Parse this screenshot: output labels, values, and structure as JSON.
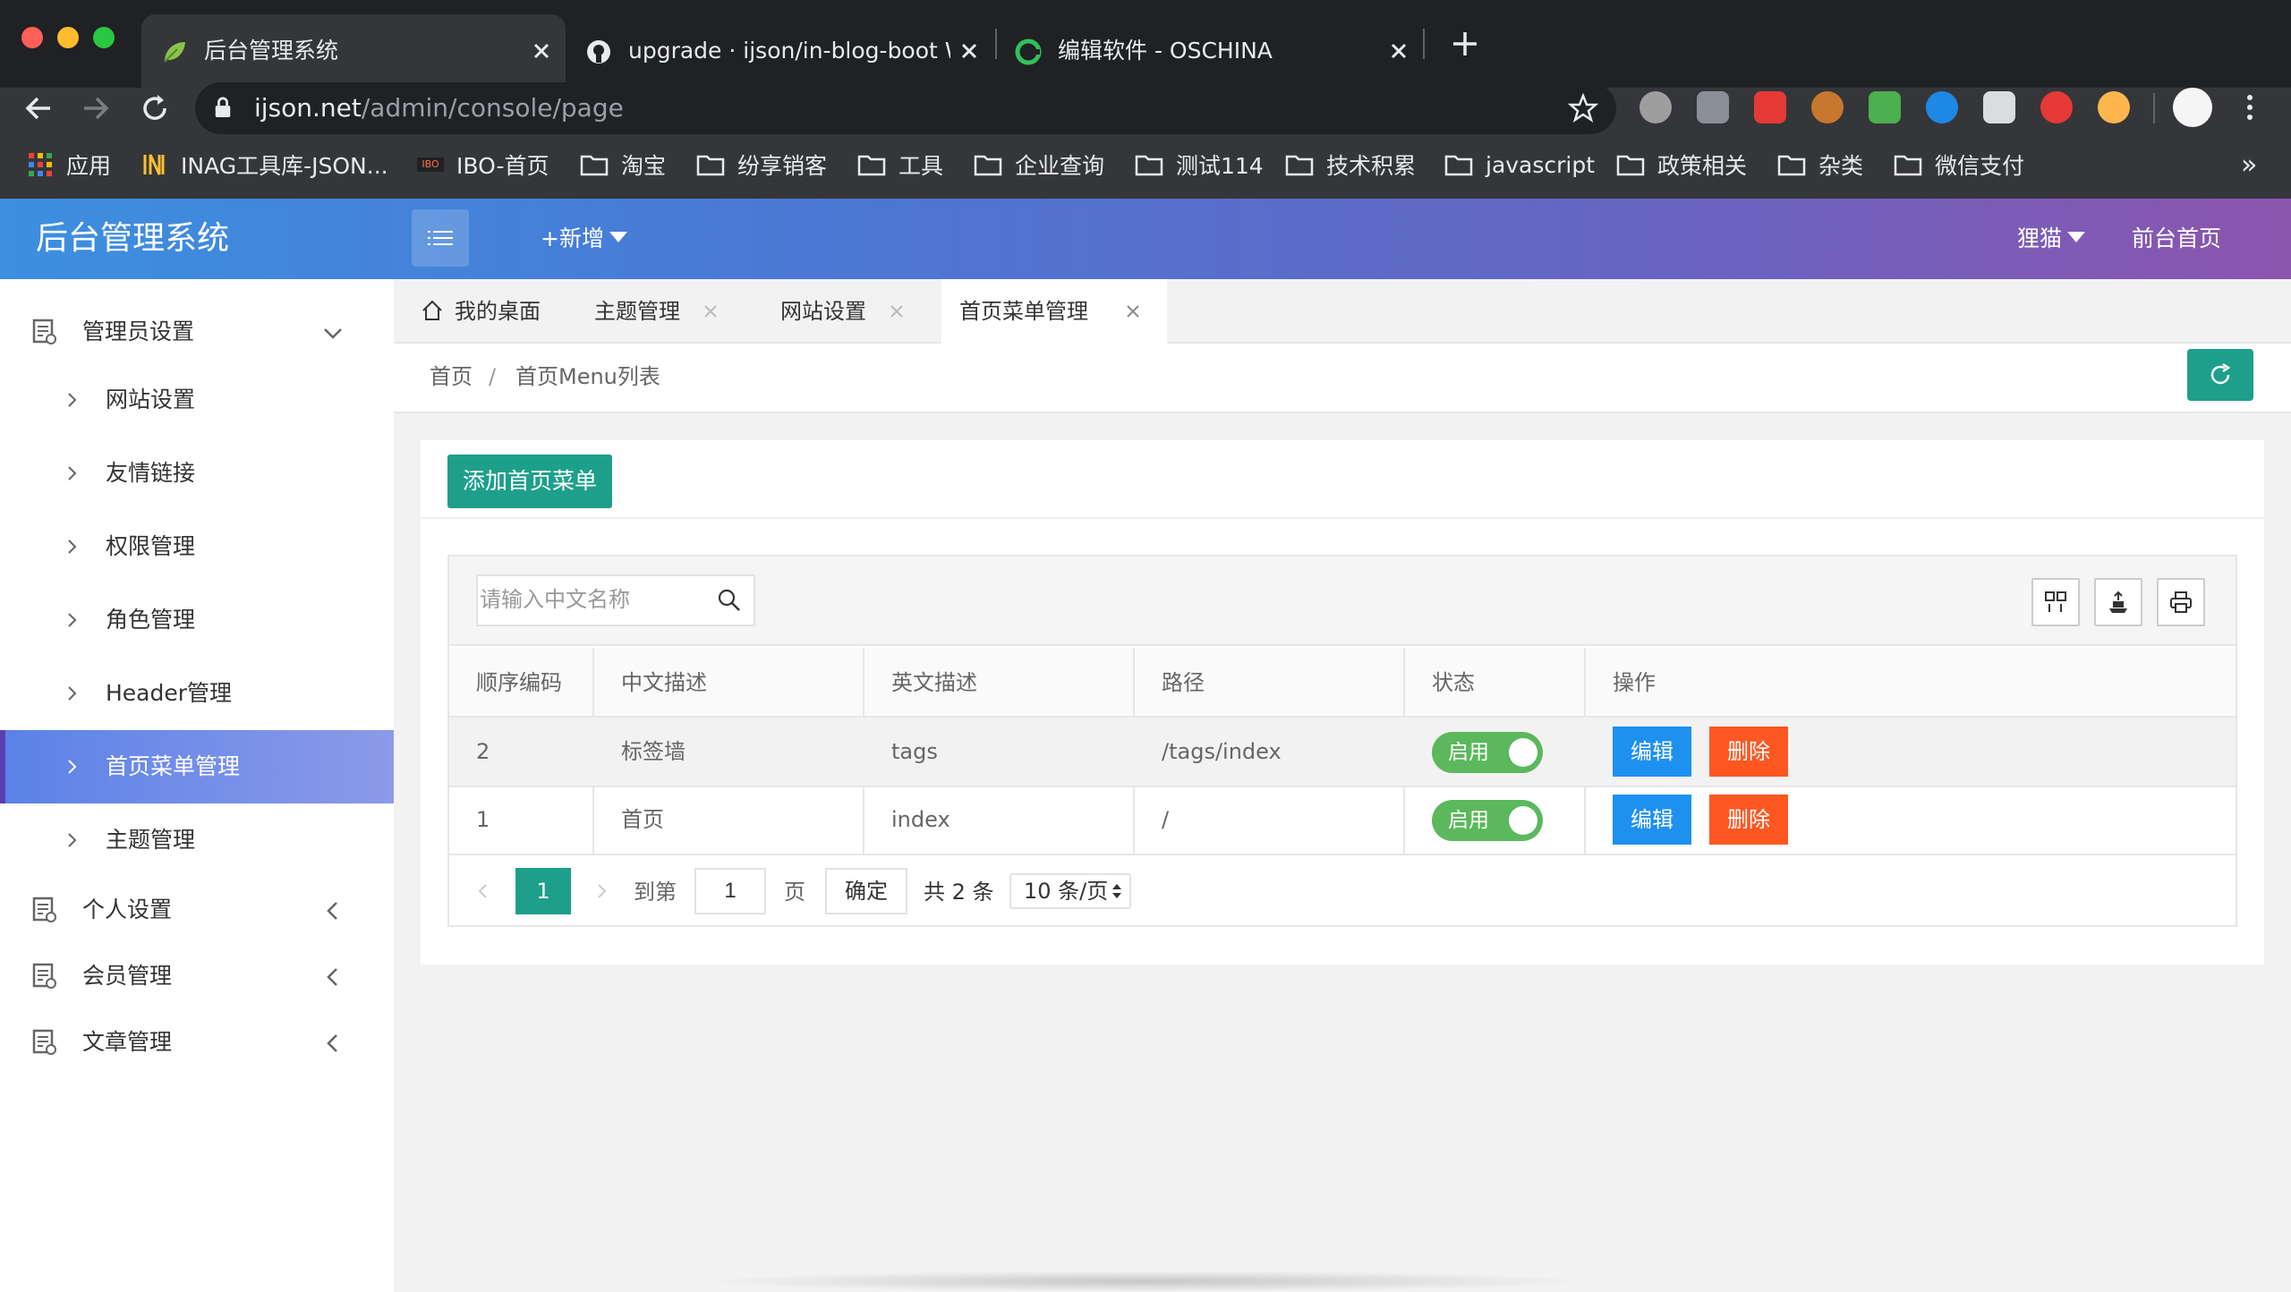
{
  "browser": {
    "tabs": [
      {
        "title": "后台管理系统",
        "favicon": "leaf-icon",
        "active": true
      },
      {
        "title": "upgrade · ijson/in-blog-boot W",
        "favicon": "github-icon",
        "active": false
      },
      {
        "title": "编辑软件 - OSCHINA",
        "favicon": "oschina-icon",
        "active": false
      }
    ],
    "new_tab_symbol": "+",
    "url_host": "ijson.net",
    "url_path": "/admin/console/page",
    "bookmarks": [
      {
        "label": "应用",
        "icon": "apps-grid-icon"
      },
      {
        "label": "INAG工具库-JSON...",
        "icon": "inag-logo-icon"
      },
      {
        "label": "IBO-首页",
        "icon": "ibo-logo-icon"
      },
      {
        "label": "淘宝",
        "icon": "folder-icon"
      },
      {
        "label": "纷享销客",
        "icon": "folder-icon"
      },
      {
        "label": "工具",
        "icon": "folder-icon"
      },
      {
        "label": "企业查询",
        "icon": "folder-icon"
      },
      {
        "label": "测试114",
        "icon": "folder-icon"
      },
      {
        "label": "技术积累",
        "icon": "folder-icon"
      },
      {
        "label": "javascript",
        "icon": "folder-icon"
      },
      {
        "label": "政策相关",
        "icon": "folder-icon"
      },
      {
        "label": "杂类",
        "icon": "folder-icon"
      },
      {
        "label": "微信支付",
        "icon": "folder-icon"
      }
    ],
    "bookmarks_overflow": "»"
  },
  "header": {
    "logo": "后台管理系统",
    "new_label": "+新增",
    "user_label": "狸猫",
    "frontend_label": "前台首页",
    "colors": {
      "gradient_start": "#3d8fe0",
      "gradient_end": "#8c55ae"
    }
  },
  "sidebar": {
    "groups": [
      {
        "label": "管理员设置",
        "expanded": true,
        "items": [
          {
            "label": "网站设置",
            "active": false
          },
          {
            "label": "友情链接",
            "active": false
          },
          {
            "label": "权限管理",
            "active": false
          },
          {
            "label": "角色管理",
            "active": false
          },
          {
            "label": "Header管理",
            "active": false
          },
          {
            "label": "首页菜单管理",
            "active": true
          },
          {
            "label": "主题管理",
            "active": false
          }
        ]
      },
      {
        "label": "个人设置",
        "expanded": false
      },
      {
        "label": "会员管理",
        "expanded": false
      },
      {
        "label": "文章管理",
        "expanded": false
      }
    ]
  },
  "page_tabs": [
    {
      "label": "我的桌面",
      "home": true,
      "active": false
    },
    {
      "label": "主题管理",
      "active": false
    },
    {
      "label": "网站设置",
      "active": false
    },
    {
      "label": "首页菜单管理",
      "active": true
    }
  ],
  "breadcrumb": {
    "home": "首页",
    "separator": "/",
    "current": "首页Menu列表"
  },
  "main": {
    "add_button": "添加首页菜单",
    "search_placeholder": "请输入中文名称",
    "table": {
      "columns": [
        "顺序编码",
        "中文描述",
        "英文描述",
        "路径",
        "状态",
        "操作"
      ],
      "rows": [
        {
          "order": "2",
          "cn": "标签墙",
          "en": "tags",
          "path": "/tags/index",
          "status": "启用",
          "edit": "编辑",
          "delete": "删除"
        },
        {
          "order": "1",
          "cn": "首页",
          "en": "index",
          "path": "/",
          "status": "启用",
          "edit": "编辑",
          "delete": "删除"
        }
      ]
    },
    "pagination": {
      "current_page": "1",
      "goto_label": "到第",
      "goto_value": "1",
      "page_unit": "页",
      "confirm": "确定",
      "total": "共 2 条",
      "page_size": "10 条/页"
    },
    "colors": {
      "primary": "#1e9f8c",
      "edit": "#1e90f0",
      "delete": "#ff5722",
      "switch_on": "#5cb85c"
    }
  }
}
